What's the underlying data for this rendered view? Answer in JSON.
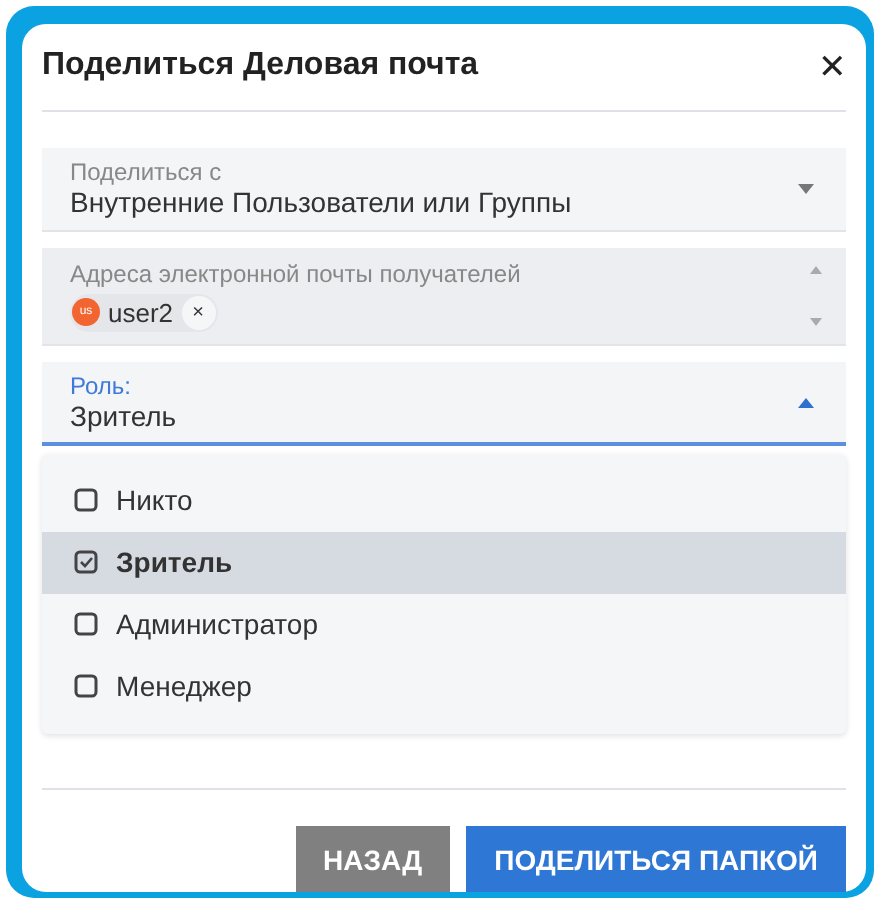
{
  "dialog": {
    "title": "Поделиться Деловая почта",
    "close": "✕"
  },
  "share_with": {
    "label": "Поделиться с",
    "value": "Внутренние Пользователи или Группы"
  },
  "recipients": {
    "label": "Адреса электронной почты получателей",
    "chips": [
      {
        "avatar": "us",
        "text": "user2",
        "remove": "×",
        "color": "#f26430"
      }
    ]
  },
  "role": {
    "label": "Роль:",
    "value": "Зритель",
    "expanded": true
  },
  "role_options": [
    {
      "label": "Никто",
      "selected": false
    },
    {
      "label": "Зритель",
      "selected": true
    },
    {
      "label": "Администратор",
      "selected": false
    },
    {
      "label": "Менеджер",
      "selected": false
    }
  ],
  "buttons": [
    {
      "label": "НАЗАД",
      "kind": "secondary"
    },
    {
      "label": "ПОДЕЛИТЬСЯ ПАПКОЙ",
      "kind": "primary"
    }
  ]
}
